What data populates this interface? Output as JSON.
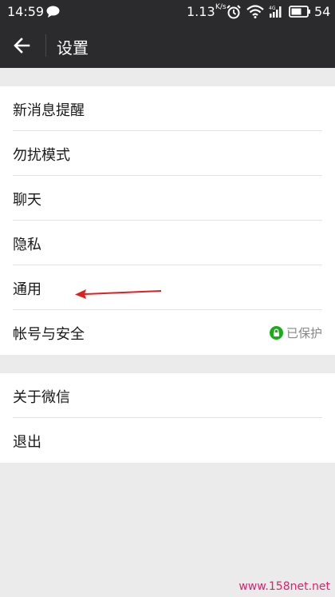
{
  "status_bar": {
    "time": "14:59",
    "speed": "1.13",
    "speed_unit": "K/s",
    "network": "4G",
    "battery": "54"
  },
  "app_bar": {
    "title": "设置"
  },
  "groups": [
    {
      "items": [
        {
          "label": "新消息提醒"
        },
        {
          "label": "勿扰模式"
        },
        {
          "label": "聊天"
        },
        {
          "label": "隐私"
        },
        {
          "label": "通用"
        },
        {
          "label": "帐号与安全",
          "status": "已保护"
        }
      ]
    },
    {
      "items": [
        {
          "label": "关于微信"
        },
        {
          "label": "退出"
        }
      ]
    }
  ],
  "annotation": {
    "arrow_color": "#e02020",
    "points_to": "通用"
  },
  "watermark": "www.158net.net",
  "colors": {
    "bar_bg": "#2b2b2d",
    "page_bg": "#ebebeb",
    "protect_green": "#1aad19"
  }
}
